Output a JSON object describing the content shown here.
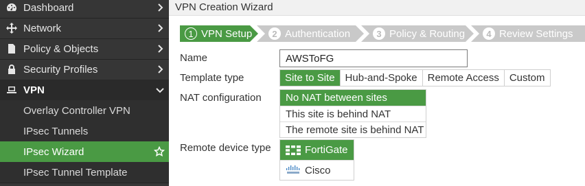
{
  "sidebar": {
    "items": [
      {
        "label": "Dashboard",
        "icon": "dashboard-icon"
      },
      {
        "label": "Network",
        "icon": "network-icon"
      },
      {
        "label": "Policy & Objects",
        "icon": "policy-icon"
      },
      {
        "label": "Security Profiles",
        "icon": "lock-icon"
      },
      {
        "label": "VPN",
        "icon": "laptop-icon"
      }
    ],
    "vpn_submenu": [
      {
        "label": "Overlay Controller VPN"
      },
      {
        "label": "IPsec Tunnels"
      },
      {
        "label": "IPsec Wizard",
        "active": true
      },
      {
        "label": "IPsec Tunnel Template"
      }
    ]
  },
  "page": {
    "title": "VPN Creation Wizard"
  },
  "wizard": {
    "steps": [
      {
        "num": "1",
        "label": "VPN Setup",
        "active": true
      },
      {
        "num": "2",
        "label": "Authentication"
      },
      {
        "num": "3",
        "label": "Policy & Routing"
      },
      {
        "num": "4",
        "label": "Review Settings"
      }
    ]
  },
  "form": {
    "name_label": "Name",
    "name_value": "AWSToFG",
    "template_type_label": "Template type",
    "template_types": [
      "Site to Site",
      "Hub-and-Spoke",
      "Remote Access",
      "Custom"
    ],
    "nat_label": "NAT configuration",
    "nat_options": [
      "No NAT between sites",
      "This site is behind NAT",
      "The remote site is behind NAT"
    ],
    "remote_device_label": "Remote device type",
    "remote_devices": [
      {
        "label": "FortiGate",
        "icon": "fortigate-logo"
      },
      {
        "label": "Cisco",
        "icon": "cisco-logo"
      }
    ]
  },
  "colors": {
    "accent": "#4a9a44",
    "sidebar_bg": "#363636",
    "step_inactive": "#c9c9c9"
  }
}
